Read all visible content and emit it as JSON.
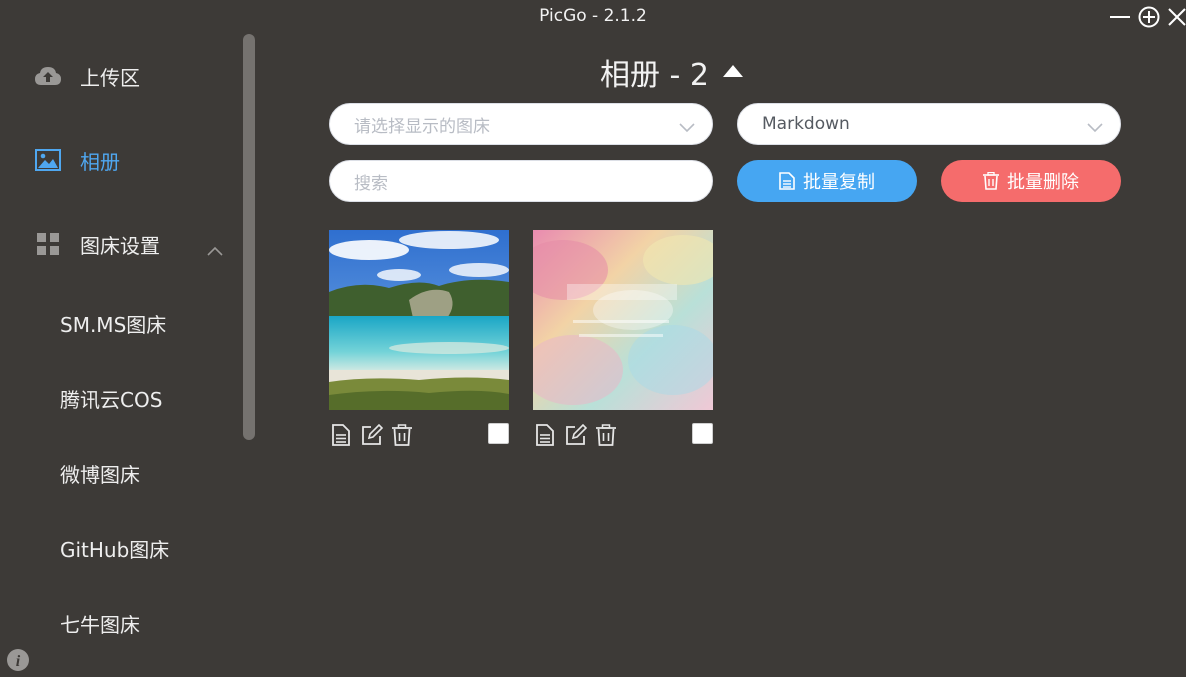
{
  "window": {
    "title": "PicGo - 2.1.2",
    "controls": [
      "minimize-icon",
      "maximize-icon",
      "close-icon"
    ]
  },
  "sidebar": {
    "items": [
      {
        "label": "上传区",
        "icon": "cloud-upload-icon",
        "active": false
      },
      {
        "label": "相册",
        "icon": "picture-icon",
        "active": true
      },
      {
        "label": "图床设置",
        "icon": "grid-icon",
        "active": false,
        "expanded": true
      }
    ],
    "sub_items": [
      "SM.MS图床",
      "腾讯云COS",
      "微博图床",
      "GitHub图床",
      "七牛图床"
    ],
    "accent_color": "#4fa7f0"
  },
  "gallery": {
    "title": "相册 - 2",
    "bed_select": {
      "placeholder": "请选择显示的图床"
    },
    "format_select": {
      "value": "Markdown"
    },
    "search": {
      "placeholder": "搜索"
    },
    "copy_button": "批量复制",
    "delete_button": "批量删除",
    "copy_color": "#46a6f2",
    "delete_color": "#f56c6c",
    "images": [
      {
        "name": "lake-landscape-thumbnail",
        "checked": false
      },
      {
        "name": "watercolor-poster-thumbnail",
        "checked": false
      }
    ]
  }
}
